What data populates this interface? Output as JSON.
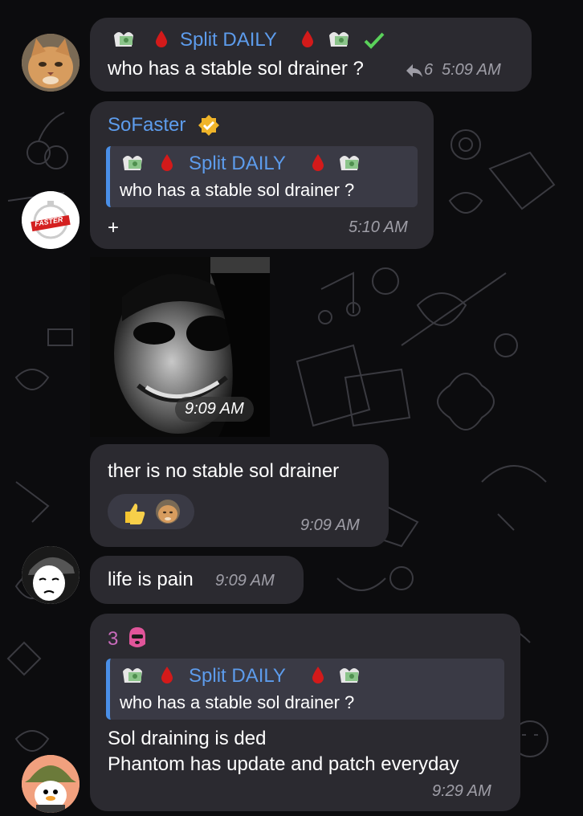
{
  "theme": {
    "background": "#0c0c0e",
    "bubble": "#2b2a30",
    "accent_blue": "#5d9cec",
    "name_purple": "#c86bbb",
    "check_green": "#5ad15a",
    "verified_gold": "#f0b429"
  },
  "messages": [
    {
      "sender": "Split DAILY",
      "text": "who has a stable sol drainer ?",
      "reply_count": "6",
      "time": "5:09 AM"
    },
    {
      "sender": "SoFaster",
      "quote": {
        "sender": "Split DAILY",
        "text": "who has a stable sol drainer ?"
      },
      "text": "+",
      "time": "5:10 AM",
      "avatar_label": "FASTER"
    },
    {
      "type": "photo",
      "time": "9:09 AM"
    },
    {
      "text": "ther is no stable sol drainer",
      "reactions": [
        "thumbs-up-emoji",
        "cat-avatar"
      ],
      "time": "9:09 AM"
    },
    {
      "text": "life is pain",
      "time": "9:09 AM"
    },
    {
      "sender": "3",
      "quote": {
        "sender": "Split DAILY",
        "text": "who has a stable sol drainer ?"
      },
      "text_line1": "Sol draining is ded",
      "text_line2": "Phantom has update and patch everyday",
      "time": "9:29 AM"
    }
  ],
  "icons": {
    "money": "money-with-wings-icon",
    "drop": "blood-drop-icon",
    "check": "checkmark-icon",
    "reply": "reply-arrow-icon",
    "verified": "verified-badge-icon",
    "balaclava": "balaclava-icon"
  }
}
